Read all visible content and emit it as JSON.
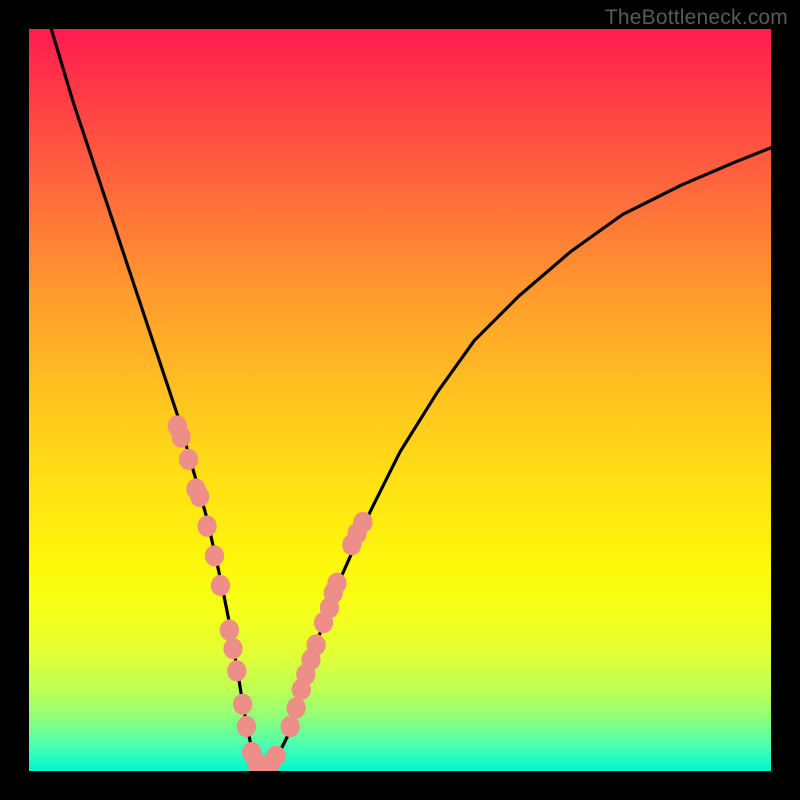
{
  "watermark": "TheBottleneck.com",
  "chart_data": {
    "type": "line",
    "title": "",
    "xlabel": "",
    "ylabel": "",
    "xlim": [
      0,
      100
    ],
    "ylim": [
      0,
      100
    ],
    "series": [
      {
        "name": "bottleneck-curve",
        "x": [
          3,
          6,
          9,
          12,
          15,
          18,
          20,
          22,
          24,
          26,
          27,
          28,
          29,
          30,
          31,
          32,
          33,
          35,
          37,
          39,
          42,
          46,
          50,
          55,
          60,
          66,
          73,
          80,
          88,
          95,
          100
        ],
        "y": [
          100,
          90,
          81,
          72,
          63,
          54,
          48,
          41,
          34,
          25,
          20,
          14,
          8,
          3,
          0,
          0,
          1,
          5,
          11,
          18,
          26,
          35,
          43,
          51,
          58,
          64,
          70,
          75,
          79,
          82,
          84
        ]
      }
    ],
    "markers_left": [
      {
        "x": 20.0,
        "y": 46.5
      },
      {
        "x": 20.5,
        "y": 45.0
      },
      {
        "x": 21.5,
        "y": 42.0
      },
      {
        "x": 22.5,
        "y": 38.0
      },
      {
        "x": 23.0,
        "y": 37.0
      },
      {
        "x": 24.0,
        "y": 33.0
      },
      {
        "x": 25.0,
        "y": 29.0
      },
      {
        "x": 25.8,
        "y": 25.0
      },
      {
        "x": 27.0,
        "y": 19.0
      },
      {
        "x": 27.5,
        "y": 16.5
      },
      {
        "x": 28.0,
        "y": 13.5
      },
      {
        "x": 28.8,
        "y": 9.0
      },
      {
        "x": 29.3,
        "y": 6.0
      }
    ],
    "markers_bottom": [
      {
        "x": 30.0,
        "y": 2.5
      },
      {
        "x": 30.7,
        "y": 1.0
      },
      {
        "x": 31.5,
        "y": 0.5
      },
      {
        "x": 32.5,
        "y": 1.0
      },
      {
        "x": 33.3,
        "y": 2.0
      }
    ],
    "markers_right": [
      {
        "x": 35.2,
        "y": 6.0
      },
      {
        "x": 36.0,
        "y": 8.5
      },
      {
        "x": 36.7,
        "y": 11.0
      },
      {
        "x": 37.3,
        "y": 13.0
      },
      {
        "x": 38.0,
        "y": 15.0
      },
      {
        "x": 38.7,
        "y": 17.0
      },
      {
        "x": 39.7,
        "y": 20.0
      },
      {
        "x": 40.5,
        "y": 22.0
      },
      {
        "x": 41.0,
        "y": 24.0
      },
      {
        "x": 41.5,
        "y": 25.3
      },
      {
        "x": 43.5,
        "y": 30.5
      },
      {
        "x": 44.2,
        "y": 32.0
      },
      {
        "x": 45.0,
        "y": 33.5
      }
    ],
    "marker_radius_data_units": 1.3,
    "marker_color": "#ed8e88",
    "palette": {
      "top": "#ff1c50",
      "mid": "#ffe313",
      "bottom": "#00f5d0",
      "curve": "#000000",
      "frame": "#000000"
    }
  }
}
